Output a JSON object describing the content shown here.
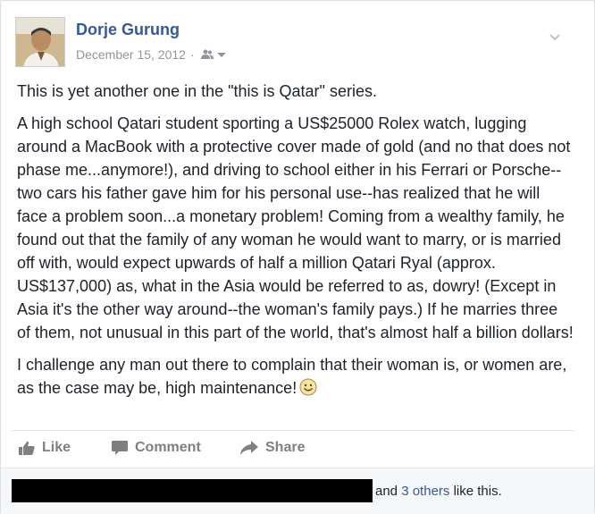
{
  "post": {
    "author": "Dorje Gurung",
    "date": "December 15, 2012",
    "separator": "·",
    "audience_icon": "friends-icon",
    "paragraphs": [
      "This is yet another one in the \"this is Qatar\" series.",
      "A high school Qatari student sporting a US$25000 Rolex watch, lugging around a MacBook with a protective cover made of gold (and no that does not phase me...anymore!), and driving to school either in his Ferrari or Porsche--two cars his father gave him for his personal use--has realized that he will face a problem soon...a monetary problem! Coming from a wealthy family, he found out that the family of any woman he would want to marry, or is married off with, would expect upwards of half a million Qatari Ryal (approx. US$137,000) as, what in the Asia would be referred to as, dowry! (Except in Asia it's the other way around--the woman's family pays.) If he marries three of them, not unusual in this part of the world, that's almost half a billion dollars!",
      "I challenge any man out there to complain that their woman is, or women are, as the case may be, high maintenance!"
    ],
    "emoji": "smiley-icon"
  },
  "actions": {
    "like_label": "Like",
    "comment_label": "Comment",
    "share_label": "Share"
  },
  "likes": {
    "prefix": "and",
    "others_link": "3 others",
    "suffix": "like this."
  },
  "colors": {
    "author_link": "#365899",
    "meta_gray": "#90949c",
    "action_gray": "#7f7f7f",
    "text": "#1d2129"
  }
}
